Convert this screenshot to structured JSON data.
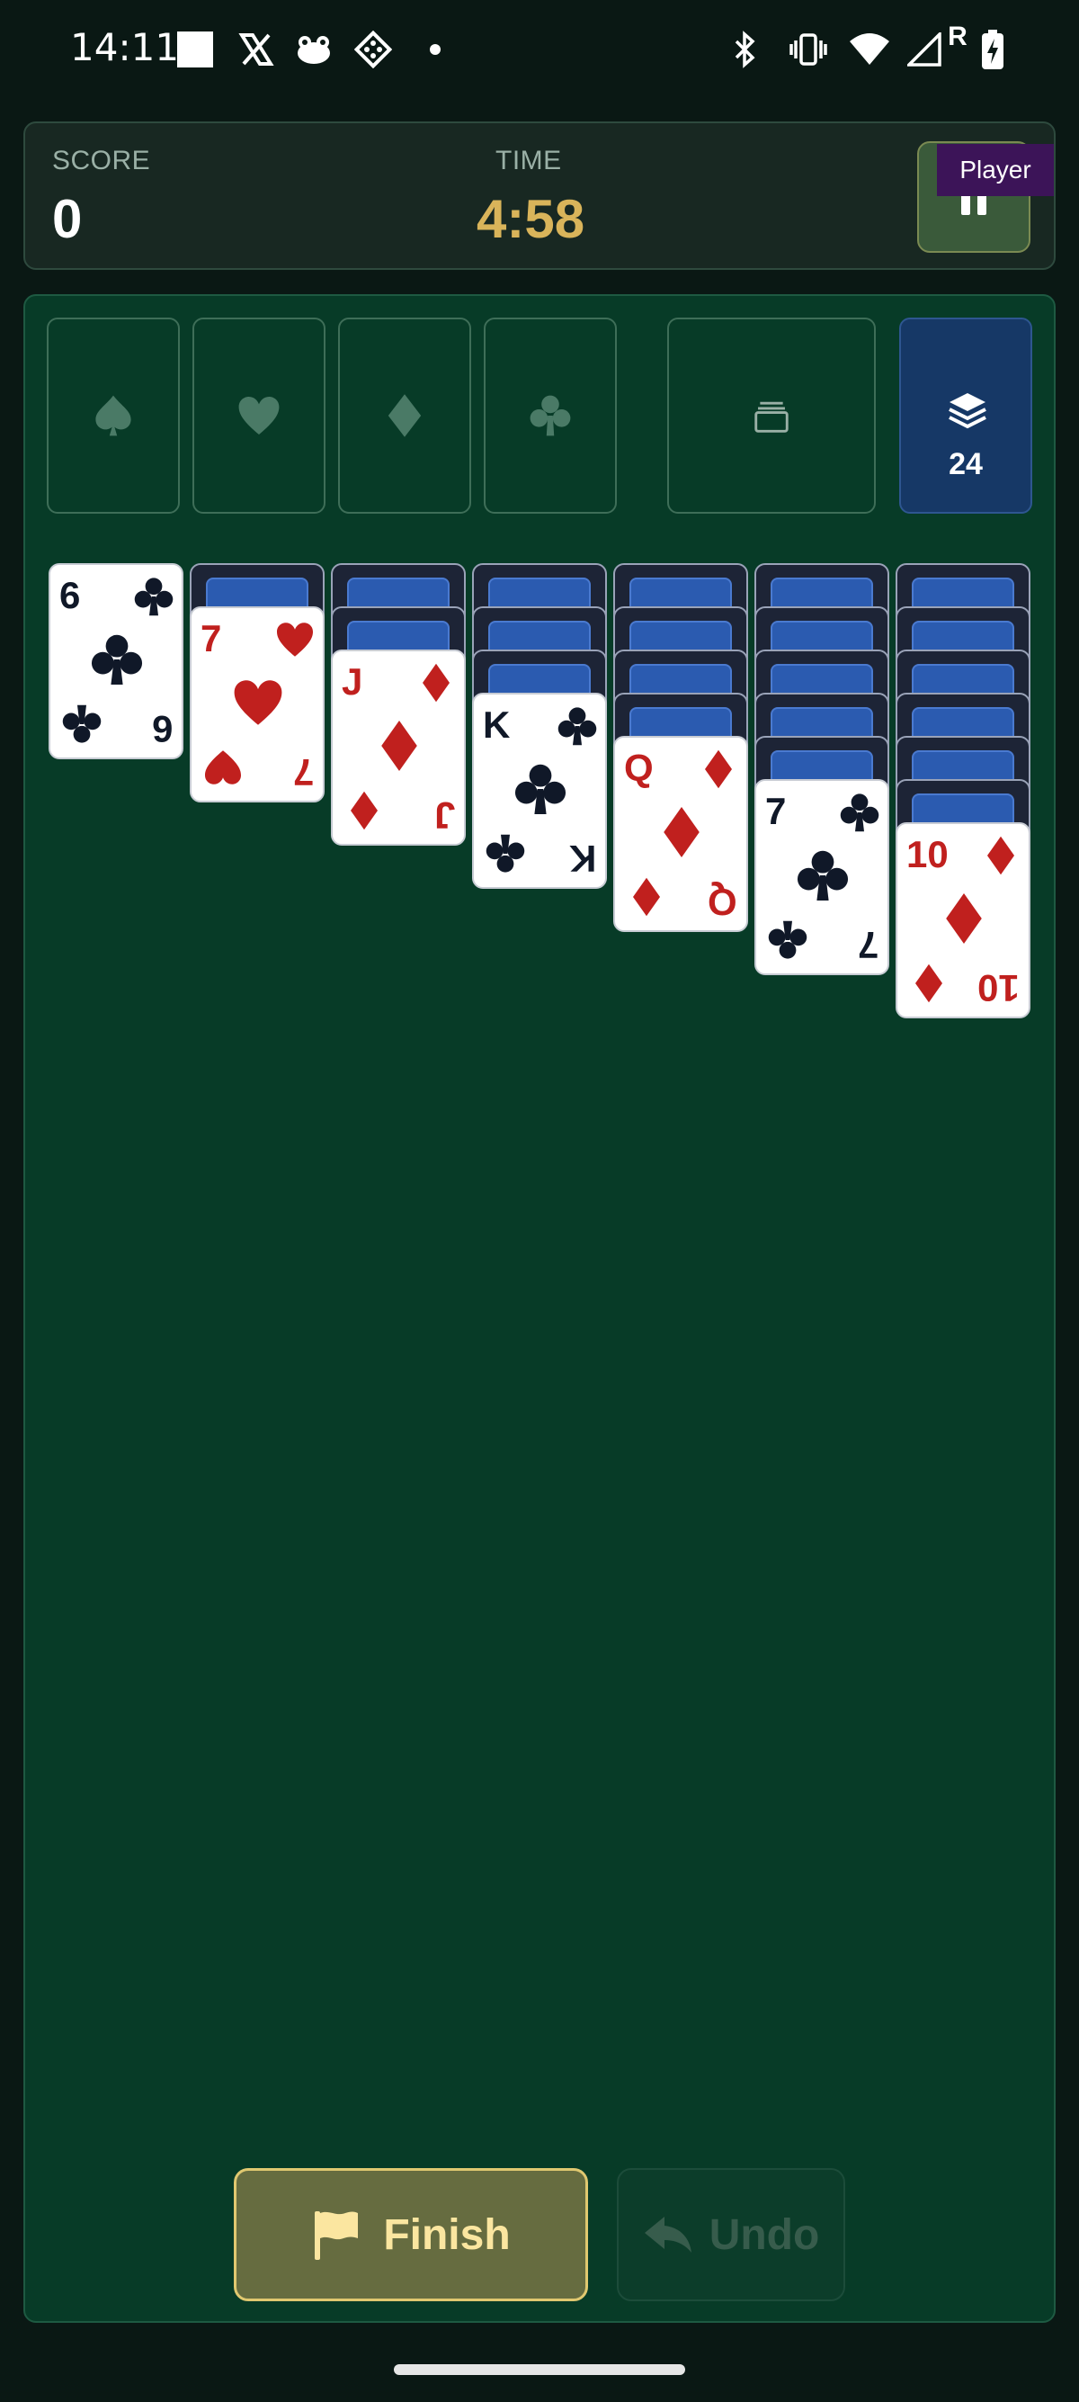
{
  "status_bar": {
    "time": "14:11",
    "left_icons": [
      "white-square-icon",
      "x-icon",
      "frog-icon",
      "diamond-grid-icon",
      "dot-icon"
    ],
    "right_icons": [
      "bluetooth-icon",
      "vibrate-icon",
      "wifi-icon",
      "signal-icon",
      "roaming-r",
      "battery-charging-icon"
    ],
    "roaming_label": "R"
  },
  "header": {
    "score_label": "SCORE",
    "score_value": "0",
    "time_label": "TIME",
    "time_value": "4:58",
    "player_badge": "Player"
  },
  "foundations": [
    {
      "suit": "spade"
    },
    {
      "suit": "heart"
    },
    {
      "suit": "diamond"
    },
    {
      "suit": "club"
    }
  ],
  "waste": {
    "icon": "empty-waste-icon"
  },
  "stock": {
    "count": "24",
    "icon": "stack-layers-icon"
  },
  "tableau": [
    {
      "hidden": 0,
      "top": {
        "rank": "6",
        "suit": "club",
        "color": "black"
      }
    },
    {
      "hidden": 1,
      "top": {
        "rank": "7",
        "suit": "heart",
        "color": "red"
      }
    },
    {
      "hidden": 2,
      "top": {
        "rank": "J",
        "suit": "diamond",
        "color": "red"
      }
    },
    {
      "hidden": 3,
      "top": {
        "rank": "K",
        "suit": "club",
        "color": "black"
      }
    },
    {
      "hidden": 4,
      "top": {
        "rank": "Q",
        "suit": "diamond",
        "color": "red"
      }
    },
    {
      "hidden": 5,
      "top": {
        "rank": "7",
        "suit": "club",
        "color": "black"
      }
    },
    {
      "hidden": 6,
      "top": {
        "rank": "10",
        "suit": "diamond",
        "color": "red"
      }
    }
  ],
  "buttons": {
    "finish_label": "Finish",
    "undo_label": "Undo"
  },
  "colors": {
    "board": "#073b27",
    "time_accent": "#d9b45a",
    "card_red": "#c0201e",
    "card_black": "#101828",
    "stock_blue": "#163866"
  }
}
